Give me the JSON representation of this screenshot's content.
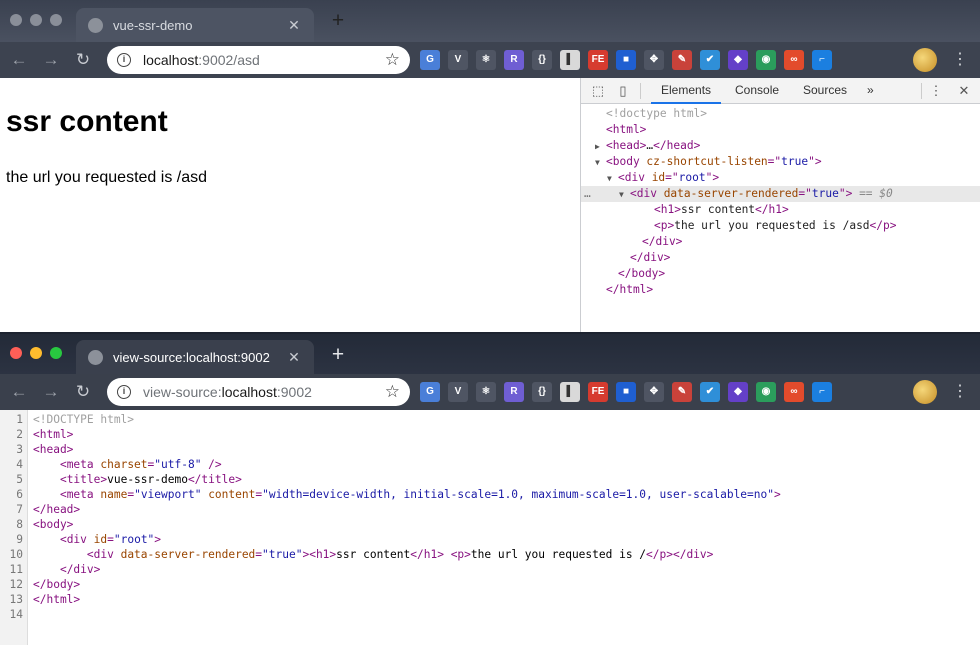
{
  "window_top": {
    "tab": {
      "title": "vue-ssr-demo"
    },
    "omnibox": {
      "host": "localhost",
      "rest": ":9002/asd"
    },
    "page": {
      "heading": "ssr content",
      "paragraph": "the url you requested is /asd"
    },
    "devtools": {
      "tabs": [
        "Elements",
        "Console",
        "Sources",
        "»"
      ],
      "dom": [
        {
          "indent": 0,
          "parts": [
            [
              "dc",
              "<!doctype html>"
            ]
          ]
        },
        {
          "indent": 0,
          "parts": [
            [
              "t",
              "<html>"
            ]
          ]
        },
        {
          "indent": 0,
          "tri": "▶",
          "parts": [
            [
              "t",
              "<head>"
            ],
            [
              "tx",
              "…"
            ],
            [
              "t",
              "</head>"
            ]
          ]
        },
        {
          "indent": 0,
          "tri": "▼",
          "parts": [
            [
              "t",
              "<body "
            ],
            [
              "an",
              "cz-shortcut-listen"
            ],
            [
              "t",
              "=\""
            ],
            [
              "av",
              "true"
            ],
            [
              "t",
              "\">"
            ]
          ]
        },
        {
          "indent": 1,
          "tri": "▼",
          "parts": [
            [
              "t",
              "<div "
            ],
            [
              "an",
              "id"
            ],
            [
              "t",
              "=\""
            ],
            [
              "av",
              "root"
            ],
            [
              "t",
              "\">"
            ]
          ]
        },
        {
          "indent": 2,
          "tri": "▼",
          "sel": true,
          "parts": [
            [
              "t",
              "<div "
            ],
            [
              "an",
              "data-server-rendered"
            ],
            [
              "t",
              "=\""
            ],
            [
              "av",
              "true"
            ],
            [
              "t",
              "\">"
            ],
            [
              "ref",
              " == $0"
            ]
          ]
        },
        {
          "indent": 4,
          "parts": [
            [
              "t",
              "<h1>"
            ],
            [
              "tx",
              "ssr content"
            ],
            [
              "t",
              "</h1>"
            ]
          ]
        },
        {
          "indent": 4,
          "parts": [
            [
              "t",
              "<p>"
            ],
            [
              "tx",
              "the url you requested is /asd"
            ],
            [
              "t",
              "</p>"
            ]
          ]
        },
        {
          "indent": 3,
          "parts": [
            [
              "t",
              "</div>"
            ]
          ]
        },
        {
          "indent": 2,
          "parts": [
            [
              "t",
              "</div>"
            ]
          ]
        },
        {
          "indent": 1,
          "parts": [
            [
              "t",
              "</body>"
            ]
          ]
        },
        {
          "indent": 0,
          "parts": [
            [
              "t",
              "</html>"
            ]
          ]
        }
      ]
    }
  },
  "window_bottom": {
    "tab": {
      "title": "view-source:localhost:9002"
    },
    "omnibox": {
      "scheme": "view-source:",
      "host": "localhost",
      "rest": ":9002"
    },
    "source_lines": [
      {
        "n": "1",
        "parts": [
          [
            "sd",
            "<!DOCTYPE html>"
          ]
        ]
      },
      {
        "n": "2",
        "parts": [
          [
            "st",
            "<html>"
          ]
        ]
      },
      {
        "n": "3",
        "parts": [
          [
            "st",
            "<head>"
          ]
        ]
      },
      {
        "n": "4",
        "parts": [
          [
            "sx",
            "    "
          ],
          [
            "st",
            "<meta "
          ],
          [
            "sa",
            "charset"
          ],
          [
            "st",
            "="
          ],
          [
            "sv",
            "\"utf-8\""
          ],
          [
            "st",
            " />"
          ]
        ]
      },
      {
        "n": "5",
        "parts": [
          [
            "sx",
            "    "
          ],
          [
            "st",
            "<title>"
          ],
          [
            "sx",
            "vue-ssr-demo"
          ],
          [
            "st",
            "</title>"
          ]
        ]
      },
      {
        "n": "6",
        "parts": [
          [
            "sx",
            "    "
          ],
          [
            "st",
            "<meta "
          ],
          [
            "sa",
            "name"
          ],
          [
            "st",
            "="
          ],
          [
            "sv",
            "\"viewport\""
          ],
          [
            "st",
            " "
          ],
          [
            "sa",
            "content"
          ],
          [
            "st",
            "="
          ],
          [
            "sv",
            "\"width=device-width, initial-scale=1.0, maximum-scale=1.0, user-scalable=no\""
          ],
          [
            "st",
            ">"
          ]
        ]
      },
      {
        "n": "7",
        "parts": [
          [
            "st",
            "</head>"
          ]
        ]
      },
      {
        "n": "8",
        "parts": [
          [
            "st",
            "<body>"
          ]
        ]
      },
      {
        "n": "9",
        "parts": [
          [
            "sx",
            "    "
          ],
          [
            "st",
            "<div "
          ],
          [
            "sa",
            "id"
          ],
          [
            "st",
            "="
          ],
          [
            "sv",
            "\"root\""
          ],
          [
            "st",
            ">"
          ]
        ]
      },
      {
        "n": "10",
        "parts": [
          [
            "sx",
            "        "
          ],
          [
            "st",
            "<div "
          ],
          [
            "sa",
            "data-server-rendered"
          ],
          [
            "st",
            "="
          ],
          [
            "sv",
            "\"true\""
          ],
          [
            "st",
            "><h1>"
          ],
          [
            "sx",
            "ssr content"
          ],
          [
            "st",
            "</h1>"
          ],
          [
            "sx",
            " "
          ],
          [
            "st",
            "<p>"
          ],
          [
            "sx",
            "the url you requested is /"
          ],
          [
            "st",
            "</p></div>"
          ]
        ]
      },
      {
        "n": "11",
        "parts": [
          [
            "sx",
            "    "
          ],
          [
            "st",
            "</div>"
          ]
        ]
      },
      {
        "n": "12",
        "parts": [
          [
            "st",
            "</body>"
          ]
        ]
      },
      {
        "n": "13",
        "parts": [
          [
            "st",
            "</html>"
          ]
        ]
      },
      {
        "n": "14",
        "parts": []
      }
    ]
  },
  "extensions": [
    {
      "name": "translate-extension-icon",
      "label": "G",
      "color": "#4a7fd8"
    },
    {
      "name": "vue-devtools-icon",
      "label": "V",
      "color": "#4f5563"
    },
    {
      "name": "react-devtools-icon",
      "label": "⚛",
      "color": "#4f5563"
    },
    {
      "name": "redux-extension-icon",
      "label": "R",
      "color": "#6f5ed3"
    },
    {
      "name": "json-extension-icon",
      "label": "{}",
      "color": "#4f5563"
    },
    {
      "name": "page-extension-icon",
      "label": "▌",
      "color": "#d9d9d9"
    },
    {
      "name": "fe-extension-icon",
      "label": "FE",
      "color": "#d63b2f"
    },
    {
      "name": "square-extension-icon",
      "label": "■",
      "color": "#1f5fd1"
    },
    {
      "name": "move-extension-icon",
      "label": "✥",
      "color": "#4f5563"
    },
    {
      "name": "pen-extension-icon",
      "label": "✎",
      "color": "#c9423a"
    },
    {
      "name": "v-check-extension-icon",
      "label": "✔",
      "color": "#2f8fd8"
    },
    {
      "name": "layers-extension-icon",
      "label": "◆",
      "color": "#6440c8"
    },
    {
      "name": "color-picker-extension-icon",
      "label": "◉",
      "color": "#2b9d5c"
    },
    {
      "name": "infinity-extension-icon",
      "label": "∞",
      "color": "#e34b2c"
    },
    {
      "name": "screenshot-extension-icon",
      "label": "⌐",
      "color": "#1b7fe0"
    }
  ]
}
